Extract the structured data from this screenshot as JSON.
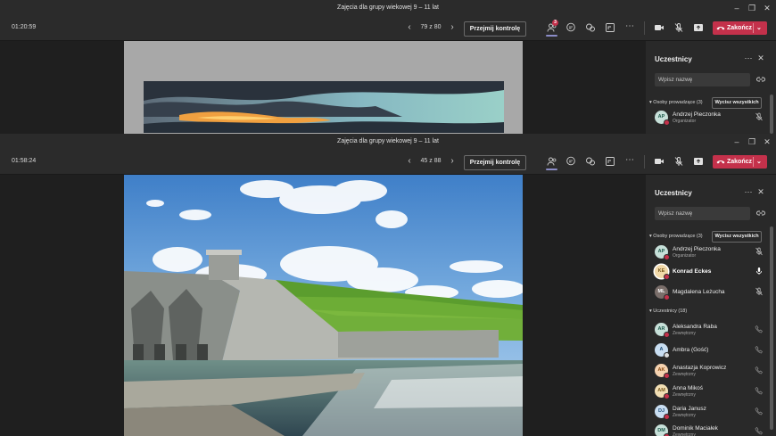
{
  "windows": [
    {
      "title": "Zajęcia dla grupy wiekowej 9 – 11 lat",
      "timer": "01:20:59",
      "page_counter": "79 z 80",
      "take_control_label": "Przejmij kontrolę",
      "participants_badge": "3",
      "end_label": "Zakończ",
      "panel_title": "Uczestnicy",
      "search_placeholder": "Wpisz nazwę",
      "presenters_heading": "Osoby prowadzące (3)",
      "mute_all_label": "Wycisz wszystkich",
      "presenters": [
        {
          "initials": "AP",
          "name": "Andrzej Pieczonka",
          "role": "Organizator"
        }
      ]
    },
    {
      "title": "Zajęcia dla grupy wiekowej 9 – 11 lat",
      "timer": "01:58:24",
      "page_counter": "45 z 88",
      "take_control_label": "Przejmij kontrolę",
      "end_label": "Zakończ",
      "panel_title": "Uczestnicy",
      "search_placeholder": "Wpisz nazwę",
      "presenters_heading": "Osoby prowadzące (3)",
      "mute_all_label": "Wycisz wszystkich",
      "attendees_heading": "Uczestnicy (18)",
      "presenters": [
        {
          "initials": "AP",
          "name": "Andrzej Pieczonka",
          "role": "Organizator"
        },
        {
          "initials": "KE",
          "name": "Konrad Eckes",
          "role": ""
        },
        {
          "initials": "ML",
          "name": "Magdalena Leżucha",
          "role": ""
        }
      ],
      "attendees": [
        {
          "initials": "AR",
          "name": "Aleksandra Raba",
          "role": "Zewnętrzny"
        },
        {
          "initials": "A",
          "name": "Ambra (Gość)",
          "role": ""
        },
        {
          "initials": "AK",
          "name": "Anastazja Koprowicz",
          "role": "Zewnętrzny"
        },
        {
          "initials": "AM",
          "name": "Anna Mikoś",
          "role": "Zewnętrzny"
        },
        {
          "initials": "DJ",
          "name": "Daria Janusz",
          "role": "Zewnętrzny"
        },
        {
          "initials": "DM",
          "name": "Dominik Maciałek",
          "role": "Zewnętrzny"
        }
      ]
    }
  ],
  "colors": {
    "accent": "#8b8cc7",
    "end_call": "#c4314b",
    "toolbar": "#2b2b2b",
    "panel": "#292929",
    "stage": "#1f1f1f"
  }
}
